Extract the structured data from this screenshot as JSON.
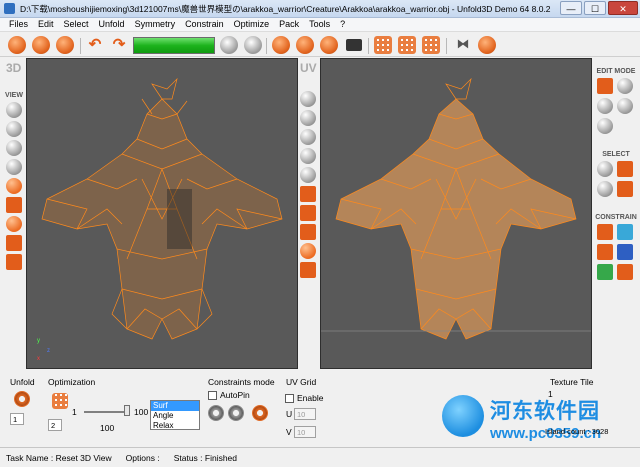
{
  "window": {
    "title": "D:\\下载\\moshoushijiemoxing\\3d121007ms\\魔兽世界模型の\\arakkoa_warrior\\Creature\\Arakkoa\\arakkoa_warrior.obj - Unfold3D Demo 64  8.0.2",
    "minimize": "—",
    "maximize": "☐",
    "close": "✕"
  },
  "menu": [
    "Files",
    "Edit",
    "Select",
    "Unfold",
    "Symmetry",
    "Constrain",
    "Optimize",
    "Pack",
    "Tools",
    "?"
  ],
  "toolbar": {
    "progress": 1.0
  },
  "viewports": {
    "left_label": "3D",
    "right_label": "UV",
    "left_panel": {
      "view_header": "VIEW"
    },
    "right_panel": {
      "edit_header": "EDIT MODE",
      "select_header": "SELECT",
      "constrain_header": "CONSTRAIN"
    },
    "axis_x": "x",
    "axis_y": "y",
    "axis_z": "z"
  },
  "bottom": {
    "unfold": {
      "label": "Unfold",
      "value": "1"
    },
    "optimization": {
      "label": "Optimization",
      "iter_value": "2",
      "slider_min": "1",
      "slider_max": "100",
      "slider_value": "100",
      "slider_value_fraction": 1.0,
      "modes": [
        "Surf",
        "Angle",
        "Relax"
      ],
      "selected_mode": "Surf"
    },
    "constraints": {
      "label": "Constraints mode",
      "autopin": "AutoPin",
      "autopin_checked": false
    },
    "uvgrid": {
      "label": "UV Grid",
      "enable": "Enable",
      "enable_checked": false,
      "u_label": "U",
      "u_value": "10",
      "v_label": "V",
      "v_value": "10"
    },
    "texture_tile": {
      "label": "Texture Tile",
      "value": "1"
    },
    "island_count": "Island count : 3028"
  },
  "status": {
    "task": "Task Name : Reset 3D View",
    "options": "Options :",
    "status": "Status : Finished"
  },
  "watermark": {
    "title": "河东软件园",
    "url": "www.pc0359.cn"
  },
  "colors": {
    "mesh": "#ff8a1c",
    "viewport_bg": "#595959",
    "progress": "#1db31d"
  }
}
